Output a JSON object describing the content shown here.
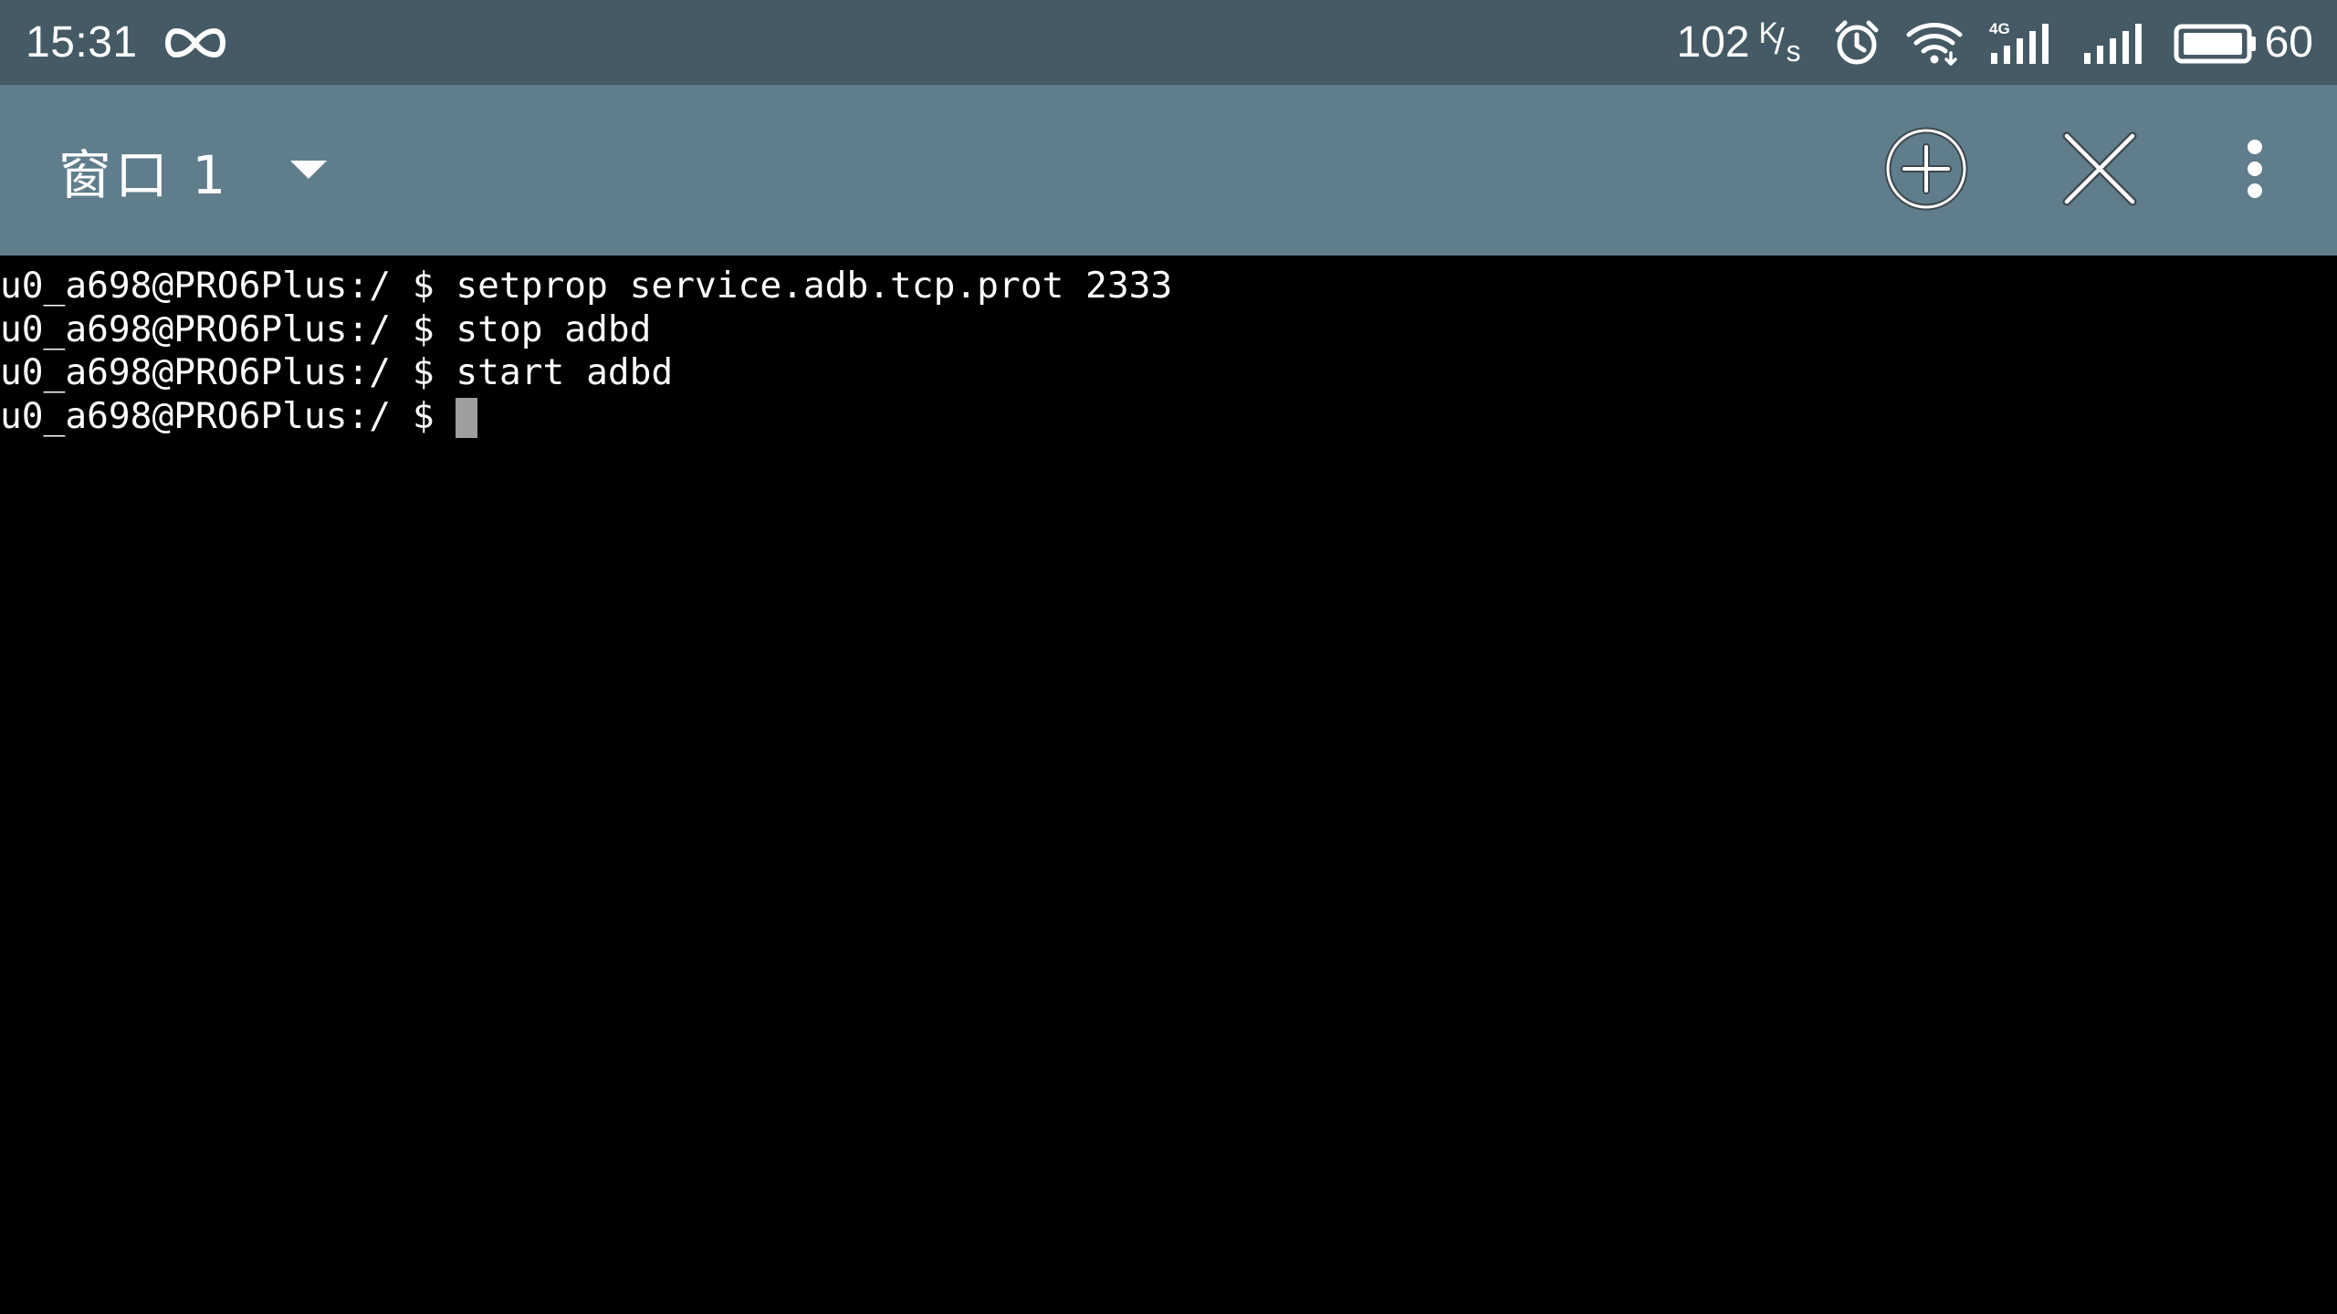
{
  "status_bar": {
    "time": "15:31",
    "net_speed_value": "102",
    "net_speed_unit_top": "K",
    "net_speed_unit_slash": "/",
    "net_speed_unit_bottom": "s",
    "network_type": "4G",
    "battery_level": "60",
    "icons": [
      "infinity-icon",
      "alarm-icon",
      "wifi-icon",
      "cellular-4g-signal-icon",
      "cellular-signal-icon",
      "battery-icon"
    ]
  },
  "action_bar": {
    "window_title": "窗口 1",
    "icons": [
      "dropdown-arrow-icon",
      "add-circle-icon",
      "close-icon",
      "more-vert-icon"
    ]
  },
  "terminal": {
    "lines": [
      "u0_a698@PRO6Plus:/ $ setprop service.adb.tcp.prot 2333",
      "u0_a698@PRO6Plus:/ $ stop adbd",
      "u0_a698@PRO6Plus:/ $ start adbd"
    ],
    "prompt": "u0_a698@PRO6Plus:/ $ ",
    "cursor_color": "#9e9e9e"
  },
  "colors": {
    "status_bar_bg": "#455A64",
    "action_bar_bg": "#607D8B",
    "terminal_bg": "#000000",
    "terminal_fg": "#ffffff"
  }
}
